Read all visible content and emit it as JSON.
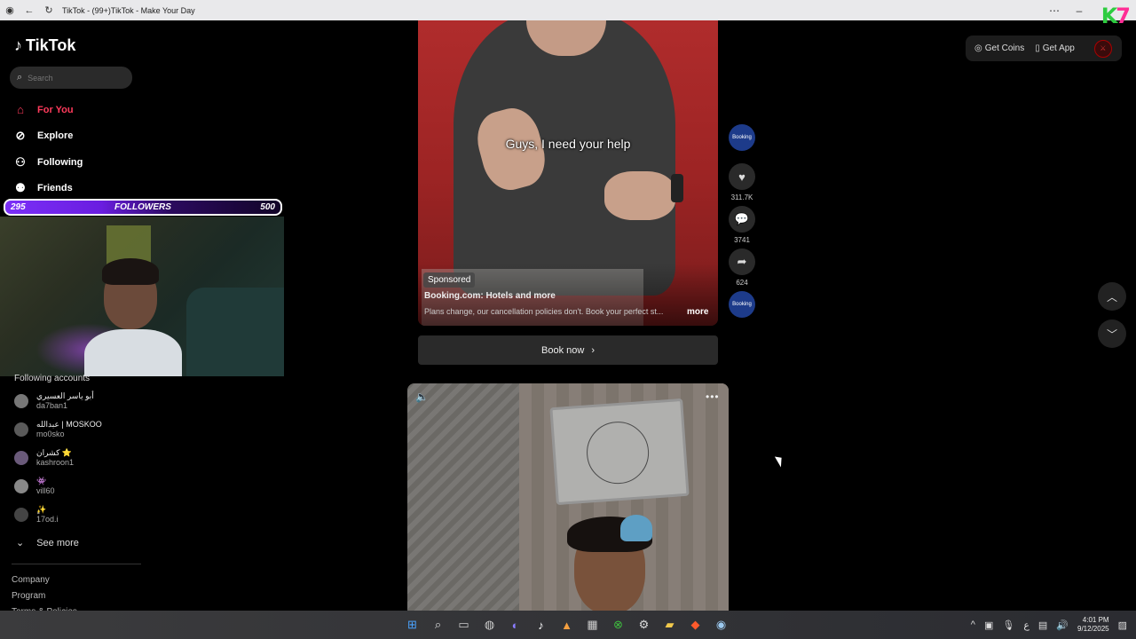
{
  "browser": {
    "title": "TikTok - (99+)TikTok - Make Your Day"
  },
  "overlay": {
    "follower_goal": {
      "current": "295",
      "label": "FOLLOWERS",
      "target": "500",
      "progress": 0.59
    },
    "logo_text": "K7"
  },
  "sidebar": {
    "logo": "TikTok",
    "search_placeholder": "Search",
    "nav": [
      {
        "label": "For You",
        "icon": "home-icon",
        "active": true
      },
      {
        "label": "Explore",
        "icon": "compass-icon",
        "active": false
      },
      {
        "label": "Following",
        "icon": "user-follow-icon",
        "active": false
      },
      {
        "label": "Friends",
        "icon": "friends-icon",
        "active": false
      }
    ],
    "following_title": "Following accounts",
    "accounts": [
      {
        "name": "أبو ياسر العسيري",
        "handle": "da7ban1"
      },
      {
        "name": "عبدالله | MOSKOO",
        "handle": "mo0sko"
      },
      {
        "name": "كشران ⭐",
        "handle": "kashroon1"
      },
      {
        "name": "👾",
        "handle": "vill60"
      },
      {
        "name": "ٍ✨",
        "handle": "17od.i"
      }
    ],
    "see_more": "See more",
    "footer": [
      "Company",
      "Program",
      "Terms & Policies"
    ]
  },
  "video1": {
    "caption": "Guys, I need your help",
    "sponsored": "Sponsored",
    "ad_title": "Booking.com: Hotels and more",
    "ad_desc": "Plans change, our cancellation policies don't. Book your perfect st...",
    "more": "more",
    "cta": "Book now",
    "brand": "Booking",
    "likes": "311.7K",
    "comments": "3741",
    "shares": "624"
  },
  "topbar": {
    "coins": "Get Coins",
    "app": "Get App"
  },
  "taskbar": {
    "time": "4:01 PM",
    "date": "9/12/2025",
    "lang": "ع"
  }
}
